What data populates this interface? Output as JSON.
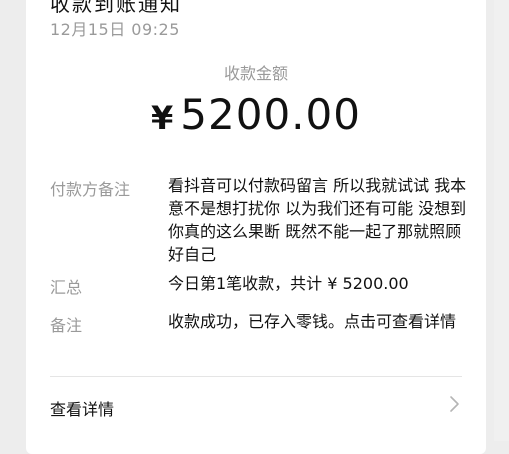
{
  "notice": {
    "title": "收款到账通知",
    "time": "12月15日 09:25"
  },
  "amount": {
    "label": "收款金额",
    "currency": "¥",
    "value": "5200.00"
  },
  "rows": [
    {
      "label": "付款方备注",
      "value": "看抖音可以付款码留言 所以我就试试 我本意不是想打扰你 以为我们还有可能 没想到你真的这么果断 既然不能一起了那就照顾好自己"
    },
    {
      "label": "汇总",
      "value": "今日第1笔收款，共计 ¥ 5200.00"
    },
    {
      "label": "备注",
      "value": "收款成功，已存入零钱。点击可查看详情"
    }
  ],
  "detail": {
    "label": "查看详情"
  },
  "icons": {
    "chevron": "chevron-right-icon"
  },
  "colors": {
    "background": "#ededed",
    "card": "#ffffff",
    "muted": "#9a9a9a",
    "text": "#111111"
  }
}
